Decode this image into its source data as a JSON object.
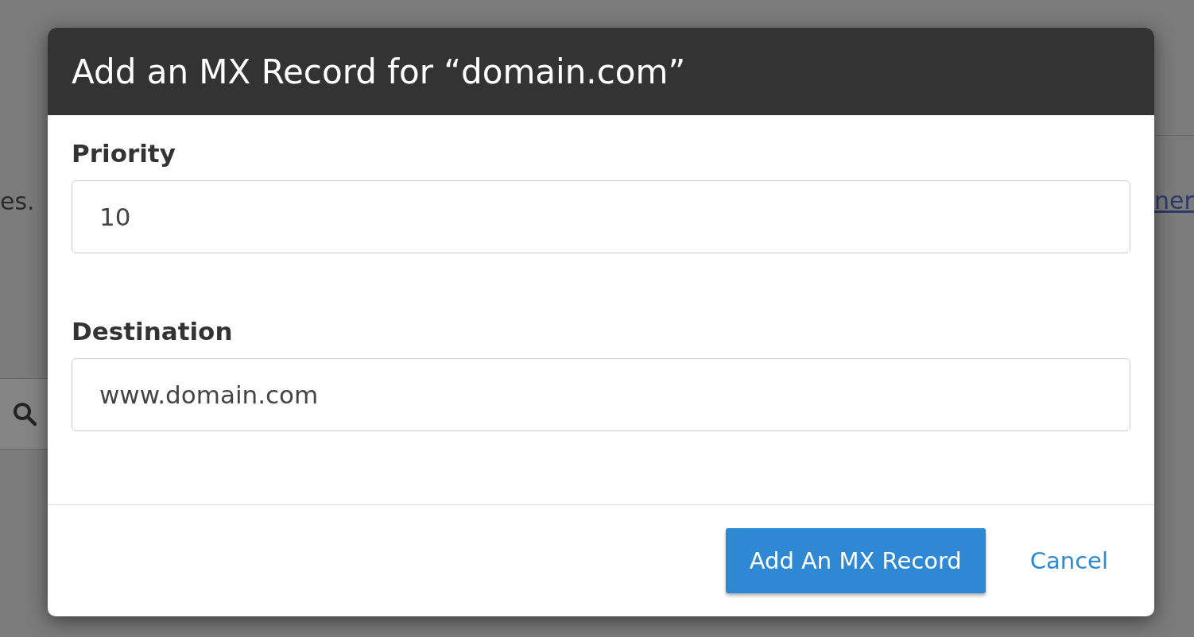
{
  "background": {
    "text_fragment": "es.",
    "link_fragment": "ner"
  },
  "dialog": {
    "title": "Add an MX Record for “domain.com”",
    "fields": [
      {
        "label": "Priority",
        "value": "10"
      },
      {
        "label": "Destination",
        "value": "www.domain.com"
      }
    ],
    "primary_button": "Add An MX Record",
    "cancel_link": "Cancel"
  }
}
